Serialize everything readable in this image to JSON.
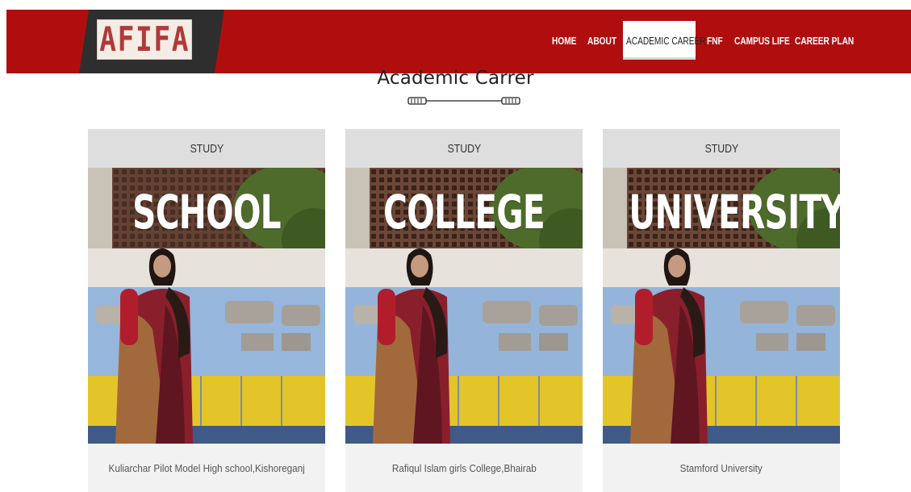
{
  "brand": {
    "logo_text": "AFIFA",
    "nav_color": "#b00e0e"
  },
  "nav": {
    "items": [
      {
        "label": "HOME"
      },
      {
        "label": "ABOUT"
      },
      {
        "label": "ACADEMIC CAREER",
        "active": true
      },
      {
        "label": "FNF"
      },
      {
        "label": "CAMPUS LIFE"
      },
      {
        "label": "CAREER PLAN"
      }
    ]
  },
  "section": {
    "title": "Academic Carrer"
  },
  "cards": [
    {
      "category": "STUDY",
      "photo_label": "SCHOOL",
      "institution": "Kuliarchar Pilot Model High school,Kishoreganj"
    },
    {
      "category": "STUDY",
      "photo_label": "COLLEGE",
      "institution": "Rafiqul Islam girls College,Bhairab"
    },
    {
      "category": "STUDY",
      "photo_label": "UNIVERSITY",
      "institution": "Stamford University"
    }
  ]
}
